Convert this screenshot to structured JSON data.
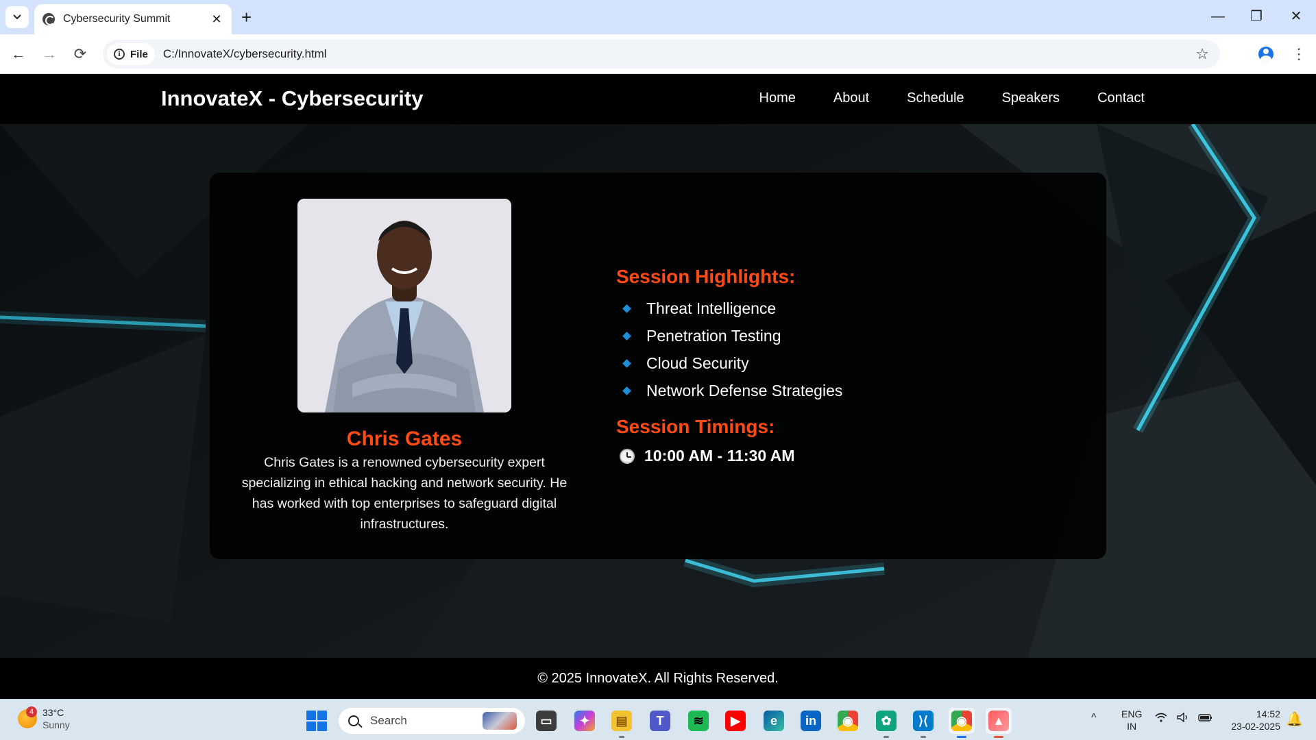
{
  "browser": {
    "tab_title": "Cybersecurity Summit",
    "tab_close": "✕",
    "new_tab": "+",
    "window_controls": {
      "minimize": "—",
      "restore": "❐",
      "close": "✕"
    },
    "nav": {
      "back": "←",
      "forward": "→",
      "reload": "⟳"
    },
    "site_chip_label": "File",
    "info_icon": "i",
    "url": "C:/InnovateX/cybersecurity.html",
    "bookmark_icon": "☆",
    "menu_icon": "⋮"
  },
  "site": {
    "brand": "InnovateX - Cybersecurity",
    "nav": [
      "Home",
      "About",
      "Schedule",
      "Speakers",
      "Contact"
    ],
    "speaker": {
      "name": "Chris Gates",
      "bio": "Chris Gates is a renowned cybersecurity expert specializing in ethical hacking and network security. He has worked with top enterprises to safeguard digital infrastructures."
    },
    "highlights_title": "Session Highlights:",
    "highlights": [
      "Threat Intelligence",
      "Penetration Testing",
      "Cloud Security",
      "Network Defense Strategies"
    ],
    "timings_title": "Session Timings:",
    "timing": "10:00 AM - 11:30 AM",
    "footer": "© 2025 InnovateX. All Rights Reserved.",
    "accent_color": "#ff4a14",
    "bullet_color": "#1c8fd6"
  },
  "taskbar": {
    "weather": {
      "badge": "4",
      "temp": "33°C",
      "condition": "Sunny"
    },
    "search_label": "Search",
    "apps": [
      {
        "name": "task-view-app",
        "glyph": "▭"
      },
      {
        "name": "copilot-app",
        "glyph": "✦"
      },
      {
        "name": "file-explorer-app",
        "glyph": "▤"
      },
      {
        "name": "teams-app",
        "glyph": "T"
      },
      {
        "name": "spotify-app",
        "glyph": "≋"
      },
      {
        "name": "youtube-app",
        "glyph": "▶"
      },
      {
        "name": "edge-app",
        "glyph": "e"
      },
      {
        "name": "linkedin-app",
        "glyph": "in"
      },
      {
        "name": "chrome-app",
        "glyph": "◉"
      },
      {
        "name": "chatgpt-app",
        "glyph": "✿"
      },
      {
        "name": "vscode-app",
        "glyph": "⟩⟨"
      },
      {
        "name": "chrome-active-app",
        "glyph": "◉"
      },
      {
        "name": "photos-app",
        "glyph": "▲"
      }
    ],
    "tray_caret": "^",
    "lang_line1": "ENG",
    "lang_line2": "IN",
    "time": "14:52",
    "date": "23-02-2025",
    "bell_icon": "🔔"
  }
}
